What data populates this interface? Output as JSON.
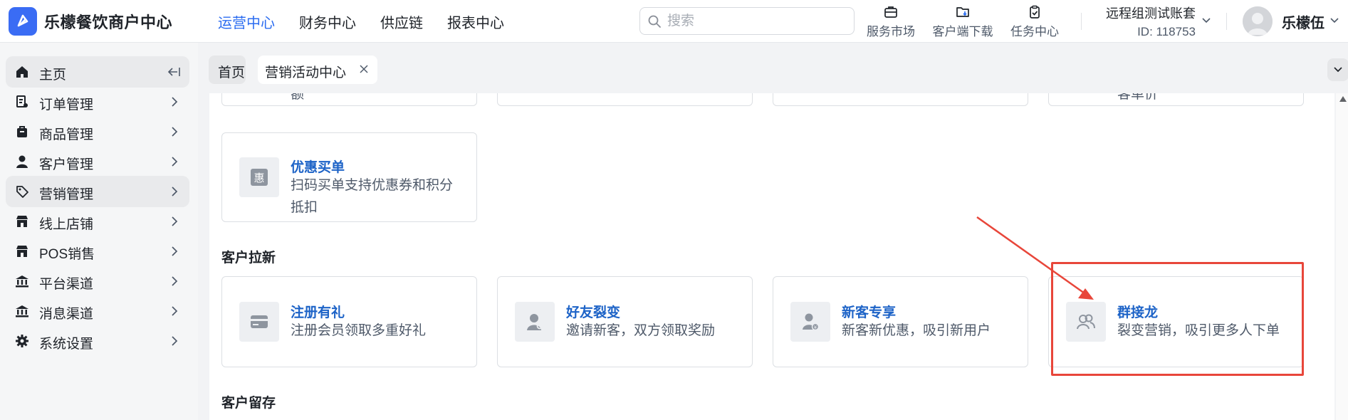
{
  "app": {
    "title": "乐檬餐饮商户中心"
  },
  "top_nav": [
    {
      "label": "运营中心",
      "active": true
    },
    {
      "label": "财务中心",
      "active": false
    },
    {
      "label": "供应链",
      "active": false
    },
    {
      "label": "报表中心",
      "active": false
    }
  ],
  "search": {
    "placeholder": "搜索",
    "value": ""
  },
  "tools": [
    {
      "label": "服务市场",
      "icon": "briefcase-icon"
    },
    {
      "label": "客户端下载",
      "icon": "download-folder-icon"
    },
    {
      "label": "任务中心",
      "icon": "clipboard-check-icon"
    }
  ],
  "account": {
    "name": "远程组测试账套",
    "id": "ID: 118753"
  },
  "user": {
    "name": "乐檬伍"
  },
  "sidebar": {
    "items": [
      {
        "label": "主页",
        "icon": "home-icon",
        "active": true
      },
      {
        "label": "订单管理",
        "icon": "order-icon"
      },
      {
        "label": "商品管理",
        "icon": "product-icon"
      },
      {
        "label": "客户管理",
        "icon": "user-icon"
      },
      {
        "label": "营销管理",
        "icon": "tag-icon",
        "active": true
      },
      {
        "label": "线上店铺",
        "icon": "store-icon"
      },
      {
        "label": "POS销售",
        "icon": "pos-store-icon"
      },
      {
        "label": "平台渠道",
        "icon": "bank-icon"
      },
      {
        "label": "消息渠道",
        "icon": "message-bank-icon"
      },
      {
        "label": "系统设置",
        "icon": "gear-icon"
      }
    ]
  },
  "tabs": [
    {
      "label": "首页"
    },
    {
      "label": "营销活动中心",
      "closable": true
    }
  ],
  "content": {
    "partial_row": [
      {
        "text": "额"
      },
      {
        "text": ""
      },
      {
        "text": ""
      },
      {
        "text": "客单价"
      }
    ],
    "top_card": {
      "title": "优惠买单",
      "desc_line1": "扫码买单支持优惠券和积分",
      "desc_line2": "抵扣",
      "icon": "discount-icon",
      "icon_char": "惠"
    },
    "sections": [
      {
        "title": "客户拉新",
        "cards": [
          {
            "title": "注册有礼",
            "desc": "注册会员领取多重好礼",
            "icon": "card-icon"
          },
          {
            "title": "好友裂变",
            "desc": "邀请新客，双方领取奖励",
            "icon": "user-search-icon"
          },
          {
            "title": "新客专享",
            "desc": "新客新优惠，吸引新用户",
            "icon": "new-user-icon"
          },
          {
            "title": "群接龙",
            "desc": "裂变营销，吸引更多人下单",
            "icon": "group-icon"
          }
        ]
      },
      {
        "title": "客户留存",
        "cards": []
      }
    ]
  },
  "colors": {
    "accent": "#2b6cf0",
    "card_title": "#1d63c7",
    "annotation": "#e8463a",
    "logo": "#3a6cf4"
  }
}
